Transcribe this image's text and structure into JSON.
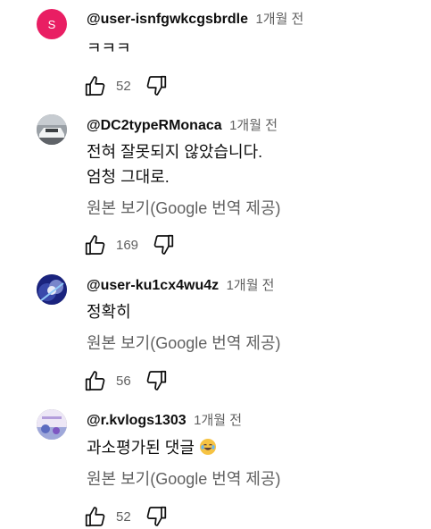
{
  "comments": [
    {
      "author": "@user-isnfgwkcgsbrdle",
      "time": "1개월 전",
      "avatar_letter": "S",
      "avatar_color": "#e91e63",
      "lines": [
        "ㅋㅋㅋ"
      ],
      "translate": "",
      "likes": "52"
    },
    {
      "author": "@DC2typeRMonaca",
      "time": "1개월 전",
      "lines": [
        "전혀 잘못되지 않았습니다.",
        "엄청 그대로."
      ],
      "translate": "원본 보기(Google 번역 제공)",
      "likes": "169"
    },
    {
      "author": "@user-ku1cx4wu4z",
      "time": "1개월 전",
      "lines": [
        "정확히"
      ],
      "translate": "원본 보기(Google 번역 제공)",
      "likes": "56"
    },
    {
      "author": "@r.kvlogs1303",
      "time": "1개월 전",
      "lines": [
        "과소평가된 댓글"
      ],
      "emoji": "face-with-tears-of-joy",
      "translate": "원본 보기(Google 번역 제공)",
      "likes": "52"
    }
  ],
  "icons": {
    "like": "thumbs-up-icon",
    "dislike": "thumbs-down-icon"
  },
  "colors": {
    "primary_text": "#0f0f0f",
    "secondary_text": "#606060",
    "avatar_s": "#e91e63"
  }
}
